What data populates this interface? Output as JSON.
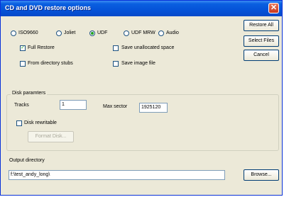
{
  "window": {
    "title": "CD and DVD restore options"
  },
  "formats": [
    {
      "label": "ISO9660",
      "checked": false
    },
    {
      "label": "Joliet",
      "checked": false
    },
    {
      "label": "UDF",
      "checked": true
    },
    {
      "label": "UDF MRW",
      "checked": false
    },
    {
      "label": "Audio",
      "checked": false
    }
  ],
  "options": {
    "full_restore": "Full Restore",
    "from_stubs": "From directory stubs",
    "save_unallocated": "Save unallocated space",
    "save_image": "Save image file"
  },
  "buttons": {
    "restore_all": "Restore All",
    "select_files": "Select Files",
    "cancel": "Cancel",
    "format_disk": "Format Disk...",
    "browse": "Browse..."
  },
  "disk": {
    "group_title": "Disk paramters",
    "tracks_label": "Tracks",
    "tracks_value": "1",
    "max_sector_label": "Max sector",
    "max_sector_value": "1925120",
    "rewritable_label": "Disk rewritable"
  },
  "output": {
    "label": "Output directory",
    "value": "f:\\test_andy_long\\"
  }
}
